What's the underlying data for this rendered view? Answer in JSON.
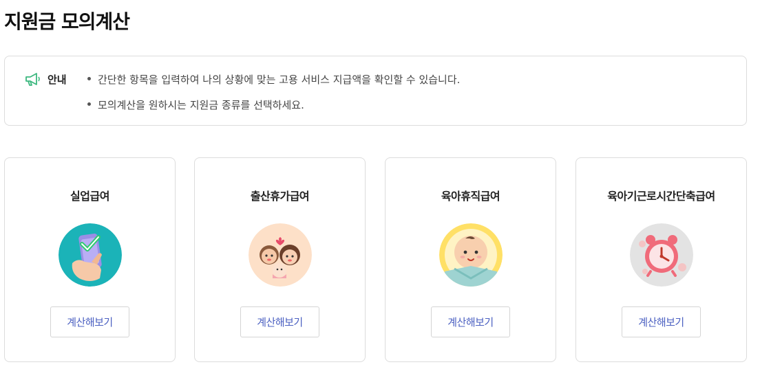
{
  "page": {
    "title": "지원금 모의계산"
  },
  "notice": {
    "label": "안내",
    "icon": "megaphone-icon",
    "icon_color": "#3bb77e",
    "lines": [
      "간단한 항목을 입력하여 나의 상황에 맞는 고용 서비스 지급액을 확인할 수 있습니다.",
      "모의계산을 원하시는 지원금 종류를 선택하세요."
    ]
  },
  "cards": [
    {
      "title": "실업급여",
      "button": "계산해보기",
      "icon": "phone-check-icon",
      "bg": "#1bb3b8"
    },
    {
      "title": "출산휴가급여",
      "button": "계산해보기",
      "icon": "family-icon",
      "bg": "#fde0c8"
    },
    {
      "title": "육아휴직급여",
      "button": "계산해보기",
      "icon": "baby-icon",
      "bg": "#ffe066"
    },
    {
      "title": "육아기근로시간단축급여",
      "button": "계산해보기",
      "icon": "alarm-clock-icon",
      "bg": "#e3e3e3"
    }
  ],
  "colors": {
    "button_text": "#4a5fc1",
    "border": "#dcdcdc"
  }
}
